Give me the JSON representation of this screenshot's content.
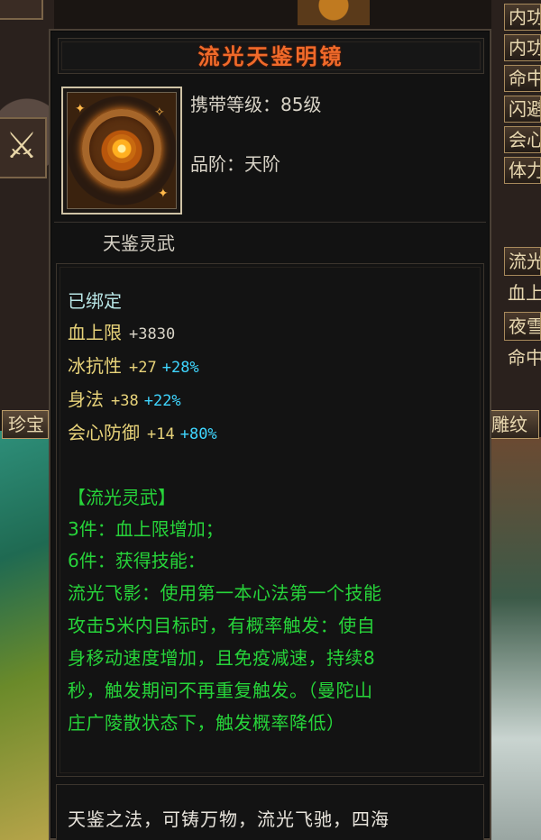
{
  "item": {
    "name": "流光天鉴明镜",
    "carry_level": "携带等级：85级",
    "grade": "品阶：天阶",
    "set_line": "天鉴灵武",
    "bound": "已绑定",
    "stats": [
      {
        "name": "血上限",
        "value": "+3830",
        "percent": ""
      },
      {
        "name": "冰抗性",
        "value": "+27",
        "percent": "+28%"
      },
      {
        "name": "身法",
        "value": "+38",
        "percent": "+22%"
      },
      {
        "name": "会心防御",
        "value": "+14",
        "percent": "+80%"
      }
    ],
    "set_title": "【流光灵武】",
    "set_bonus_3": "3件：血上限增加；",
    "set_bonus_6": "6件：获得技能：",
    "skill_desc_lines": [
      "流光飞影：使用第一本心法第一个技能",
      "攻击5米内目标时，有概率触发：使自",
      "身移动速度增加，且免疫减速，持续8",
      "秒，触发期间不再重复触发。（曼陀山",
      "庄广陵散状态下，触发概率降低）"
    ],
    "lore": "天鉴之法，可铸万物，流光飞驰，四海"
  },
  "ui": {
    "tab_left": "珍宝",
    "tab_right": "雕纹",
    "right_menu": [
      "内功",
      "内功",
      "命中",
      "闪避",
      "会心",
      "体力"
    ],
    "right_menu2": [
      "流光",
      "血上",
      "夜雪",
      "命中"
    ]
  },
  "colors": {
    "title": "#f06a2a",
    "stat_name": "#e8d37a",
    "percent": "#3fd6ff",
    "set_text": "#27d43a",
    "bound": "#b8e6e6"
  },
  "icons": [
    "mirror-item-icon",
    "sword-icon"
  ]
}
